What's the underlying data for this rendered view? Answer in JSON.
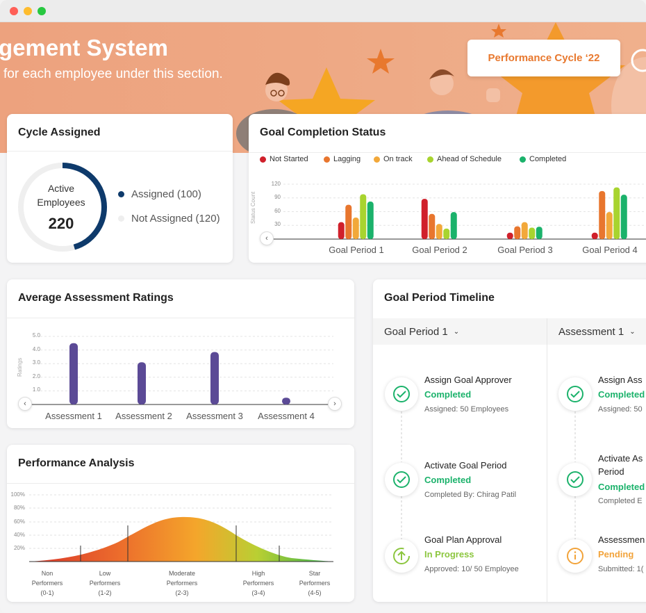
{
  "window": {
    "dots": [
      "#ff5f57",
      "#febc2e",
      "#28c840"
    ]
  },
  "banner": {
    "title": "gement System",
    "subtitle": " for each employee under this section.",
    "cycle_button": "Performance Cycle ‘22"
  },
  "cycle_assigned": {
    "title": "Cycle Assigned",
    "center_label_1": "Active",
    "center_label_2": "Employees",
    "center_value": "220",
    "legend": [
      {
        "label": "Assigned (100)",
        "color": "#0e3a6b"
      },
      {
        "label": "Not Assigned (120)",
        "color": "#eeeeee"
      }
    ],
    "assigned_fraction": 0.4545
  },
  "goal_completion": {
    "title": "Goal Completion Status",
    "ylabel": "Status Count",
    "yticks": [
      "120",
      "90",
      "60",
      "30"
    ],
    "legend": [
      {
        "label": "Not Started",
        "color": "#d0202b"
      },
      {
        "label": "Lagging",
        "color": "#e8762e"
      },
      {
        "label": "On track",
        "color": "#f2a83a"
      },
      {
        "label": "Ahead of Schedule",
        "color": "#a8d42f"
      },
      {
        "label": "Completed",
        "color": "#1bb26b"
      }
    ]
  },
  "avg_ratings": {
    "title": "Average Assessment Ratings",
    "ylabel": "Ratings",
    "yticks": [
      "5.0",
      "4.0",
      "3.0",
      "2.0",
      "1.0"
    ]
  },
  "performance": {
    "title": "Performance Analysis",
    "yticks": [
      "100%",
      "80%",
      "60%",
      "40%",
      "20%"
    ],
    "categories": [
      {
        "l1": "Non",
        "l2": "Performers",
        "l3": "(0-1)"
      },
      {
        "l1": "Low",
        "l2": "Performers",
        "l3": "(1-2)"
      },
      {
        "l1": "Moderate",
        "l2": "Performers",
        "l3": "(2-3)"
      },
      {
        "l1": "High",
        "l2": "Performers",
        "l3": "(3-4)"
      },
      {
        "l1": "Star",
        "l2": "Performers",
        "l3": "(4-5)"
      }
    ]
  },
  "timeline": {
    "title": "Goal Period Timeline",
    "col1": {
      "header": "Goal Period 1",
      "steps": [
        {
          "name": "Assign Goal Approver",
          "status": "Completed",
          "meta": "Assigned: 50 Employees",
          "color": "#1bb26b"
        },
        {
          "name": "Activate Goal Period",
          "status": "Completed",
          "meta": "Completed By: Chirag Patil",
          "color": "#1bb26b"
        },
        {
          "name": "Goal Plan Approval",
          "status": "In Progress",
          "meta": "Approved: 10/ 50 Employee",
          "color": "#8cc63f"
        }
      ]
    },
    "col2": {
      "header": "Assessment 1",
      "steps": [
        {
          "name": "Assign Ass",
          "status": "Completed",
          "meta": "Assigned: 50",
          "color": "#1bb26b"
        },
        {
          "name": "Activate As",
          "name2": "Period",
          "status": "Completed",
          "meta": "Completed E",
          "color": "#1bb26b"
        },
        {
          "name": "Assessmen",
          "status": "Pending",
          "meta": "Submitted: 1(",
          "color": "#f2a33a"
        }
      ]
    }
  },
  "chart_data": [
    {
      "type": "bar",
      "title": "Goal Completion Status",
      "ylabel": "Status Count",
      "categories": [
        "Goal Period 1",
        "Goal Period 2",
        "Goal Period 3",
        "Goal Period 4"
      ],
      "ylim": [
        0,
        120
      ],
      "series": [
        {
          "name": "Not Started",
          "values": [
            37,
            88,
            14,
            14
          ]
        },
        {
          "name": "Lagging",
          "values": [
            75,
            55,
            28,
            105
          ]
        },
        {
          "name": "On track",
          "values": [
            47,
            33,
            37,
            59
          ]
        },
        {
          "name": "Ahead of Schedule",
          "values": [
            98,
            23,
            25,
            113
          ]
        },
        {
          "name": "Completed",
          "values": [
            82,
            59,
            27,
            97
          ]
        }
      ]
    },
    {
      "type": "bar",
      "title": "Average Assessment Ratings",
      "ylabel": "Ratings",
      "categories": [
        "Assessment 1",
        "Assessment 2",
        "Assessment 3",
        "Assessment 4"
      ],
      "ylim": [
        0,
        5
      ],
      "values": [
        4.5,
        3.1,
        3.85,
        0.5
      ],
      "color": "#5b4a96"
    },
    {
      "type": "area",
      "title": "Performance Analysis",
      "ylim": [
        0,
        100
      ],
      "categories": [
        "Non Performers (0-1)",
        "Low Performers (1-2)",
        "Moderate Performers (2-3)",
        "High Performers (3-4)",
        "Star Performers (4-5)"
      ],
      "peak": 62
    }
  ]
}
